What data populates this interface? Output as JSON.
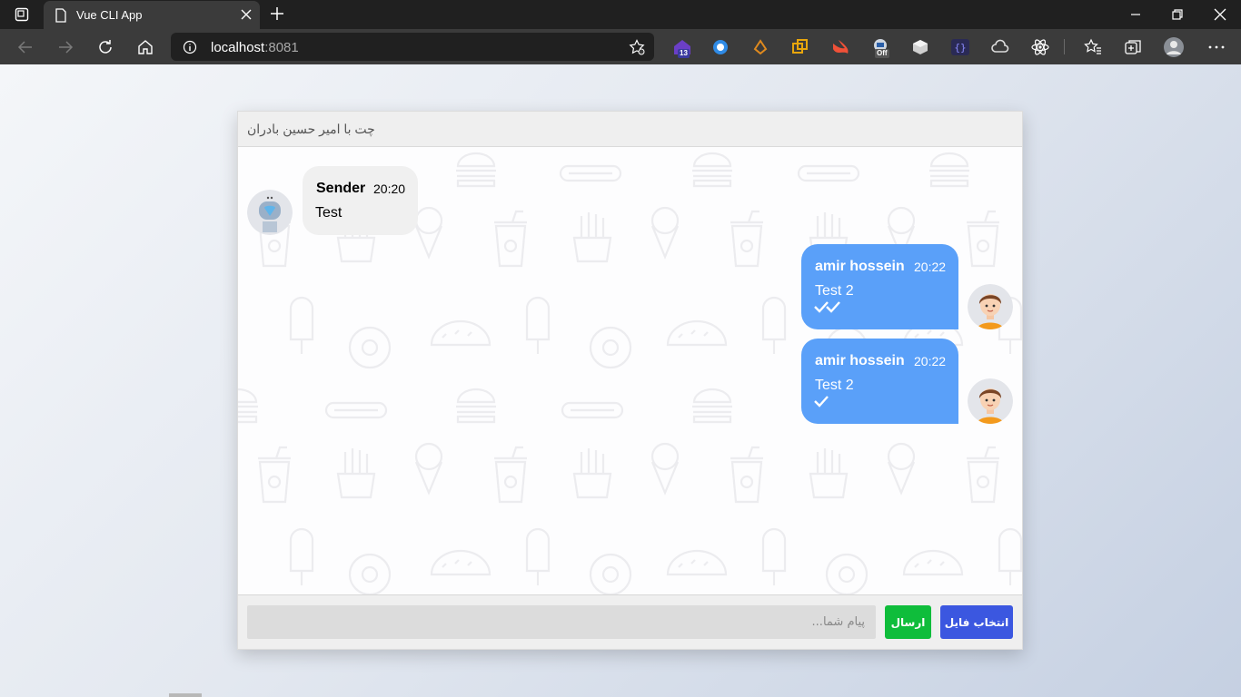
{
  "browser": {
    "tab_title": "Vue CLI App",
    "url_host": "localhost",
    "url_port": ":8081",
    "extension_badge_count": "13",
    "extension_badge_off": "Off"
  },
  "chat": {
    "header_title": "چت با امیر حسین بادران",
    "messages": [
      {
        "direction": "incoming",
        "sender": "Sender",
        "time": "20:20",
        "text": "Test",
        "avatar": "robot-avatar"
      },
      {
        "direction": "outgoing",
        "sender": "amir hossein",
        "time": "20:22",
        "text": "Test 2",
        "status": "read",
        "avatar": "boy-avatar"
      },
      {
        "direction": "outgoing",
        "sender": "amir hossein",
        "time": "20:22",
        "text": "Test 2",
        "status": "sent",
        "avatar": "boy-avatar"
      }
    ],
    "input_placeholder": "پیام شما...",
    "send_label": "ارسال",
    "file_label": "انتخاب فایل"
  },
  "colors": {
    "outgoing_bubble": "#5aa0f9",
    "incoming_bubble": "#f0f0f0",
    "send_button": "#0fbd3b",
    "file_button": "#3b57e0"
  }
}
